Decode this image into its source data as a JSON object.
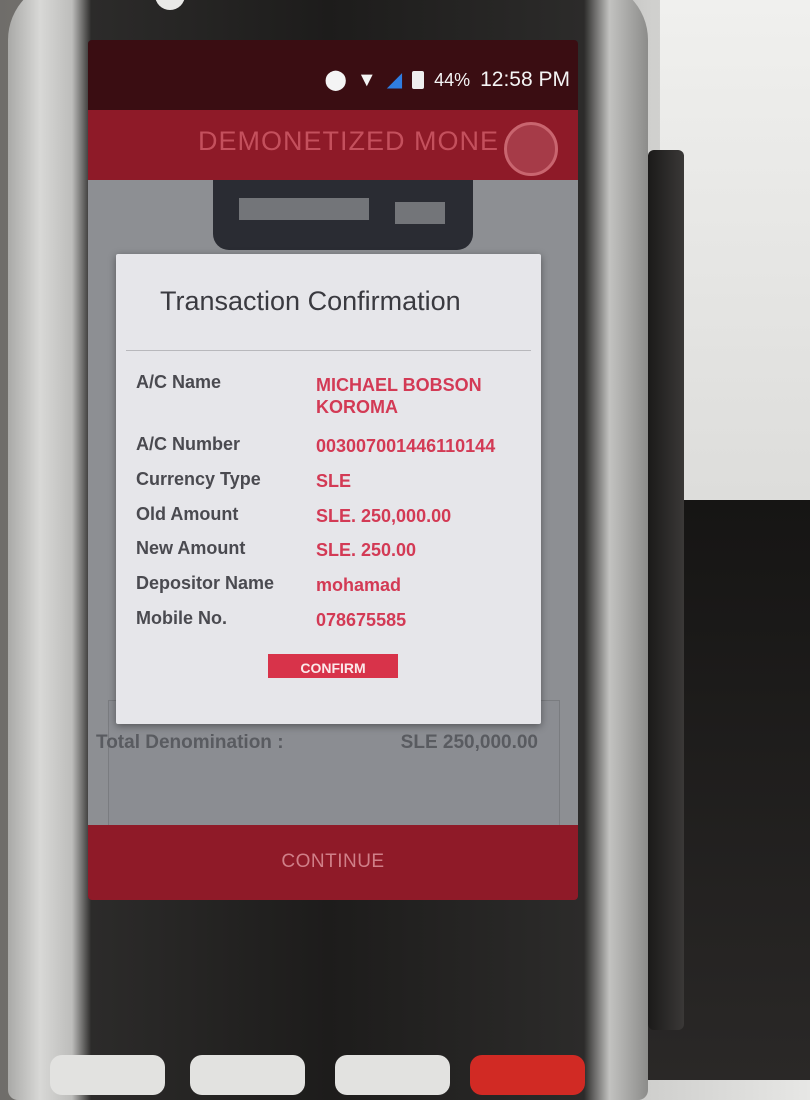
{
  "status_bar": {
    "icons": [
      "location-icon",
      "wifi-icon",
      "signal-icon",
      "battery-icon"
    ],
    "battery": "44%",
    "time": "12:58 PM"
  },
  "app": {
    "title": "DEMONETIZED MONE",
    "total_label": "Total Denomination :",
    "total_value": "SLE 250,000.00",
    "continue_label": "CONTINUE"
  },
  "dialog": {
    "title": "Transaction Confirmation",
    "fields": [
      {
        "label": "A/C Name",
        "value": "MICHAEL BOBSON KOROMA"
      },
      {
        "label": "A/C Number",
        "value": "003007001446110144"
      },
      {
        "label": "Currency Type",
        "value": "SLE"
      },
      {
        "label": "Old Amount",
        "value": "SLE. 250,000.00"
      },
      {
        "label": "New Amount",
        "value": "SLE. 250.00"
      },
      {
        "label": "Depositor Name",
        "value": "mohamad"
      },
      {
        "label": "Mobile No.",
        "value": "078675585"
      }
    ],
    "confirm_label": "CONFIRM"
  },
  "colors": {
    "accent": "#8f1a28",
    "value_text": "#d33a55",
    "confirm_button": "#d8334a"
  }
}
